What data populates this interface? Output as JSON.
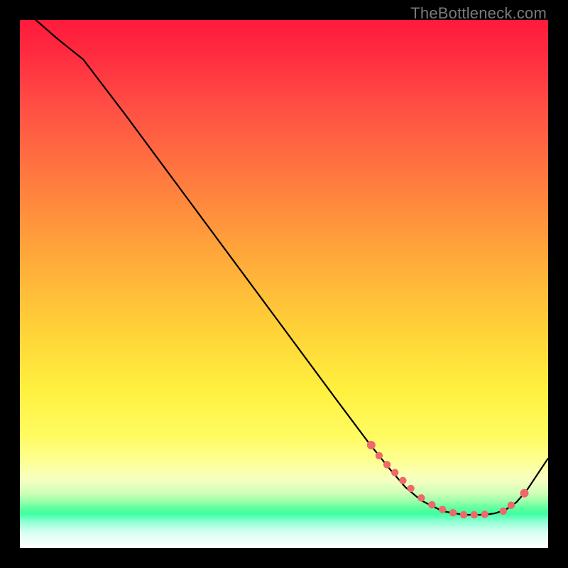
{
  "watermark": "TheBottleneck.com",
  "colors": {
    "marker": "#ee6969",
    "curve": "#000000"
  },
  "chart_data": {
    "type": "line",
    "title": "",
    "xlabel": "",
    "ylabel": "",
    "xlim": [
      0,
      100
    ],
    "ylim": [
      0,
      100
    ],
    "series": [
      {
        "name": "curve",
        "x": [
          3,
          7,
          12,
          20,
          30,
          40,
          50,
          60,
          66,
          70,
          73,
          76,
          80,
          84,
          88,
          90,
          92,
          94,
          96,
          100
        ],
        "y": [
          100,
          96.5,
          92.5,
          82,
          68.5,
          55,
          41.5,
          28,
          20,
          15,
          11.5,
          9,
          7,
          6.3,
          6.3,
          6.6,
          7.3,
          8.7,
          11,
          17
        ]
      }
    ],
    "markers": {
      "name": "highlight-points",
      "x": [
        66.5,
        68,
        69.5,
        71,
        72.5,
        74,
        76,
        78,
        80,
        82,
        84,
        86,
        88,
        91.5,
        93,
        95.5
      ],
      "y": [
        19.5,
        17.5,
        15.8,
        14.3,
        12.8,
        11.3,
        9.5,
        8.2,
        7.3,
        6.7,
        6.3,
        6.3,
        6.4,
        7.0,
        8.1,
        10.4
      ]
    }
  }
}
